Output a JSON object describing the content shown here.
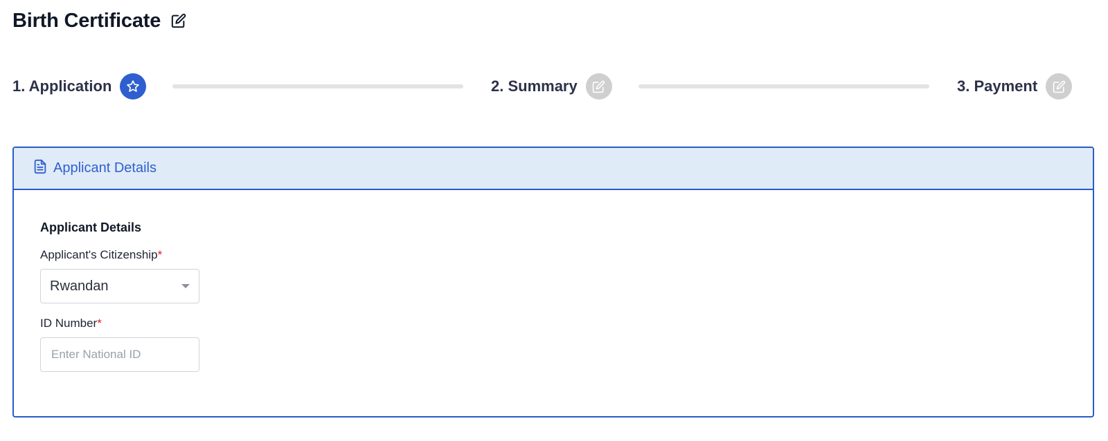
{
  "page": {
    "title": "Birth Certificate",
    "title_icon": "edit-icon"
  },
  "stepper": {
    "steps": [
      {
        "label": "1. Application",
        "icon": "star-icon",
        "status": "active"
      },
      {
        "label": "2. Summary",
        "icon": "edit-icon",
        "status": "inactive"
      },
      {
        "label": "3. Payment",
        "icon": "edit-icon",
        "status": "inactive"
      }
    ]
  },
  "panel": {
    "header_title": "Applicant Details",
    "header_icon": "document-icon",
    "section_title": "Applicant Details",
    "citizenship": {
      "label": "Applicant's Citizenship",
      "required_mark": "*",
      "value": "Rwandan"
    },
    "id_number": {
      "label": "ID Number",
      "required_mark": "*",
      "value": "",
      "placeholder": "Enter National ID"
    }
  },
  "colors": {
    "accent": "#2f5fce",
    "panel_border": "#2a5bc7",
    "panel_header_bg": "#e0ebf8",
    "inactive_step": "#cfcfcf",
    "required": "#e0182d"
  }
}
